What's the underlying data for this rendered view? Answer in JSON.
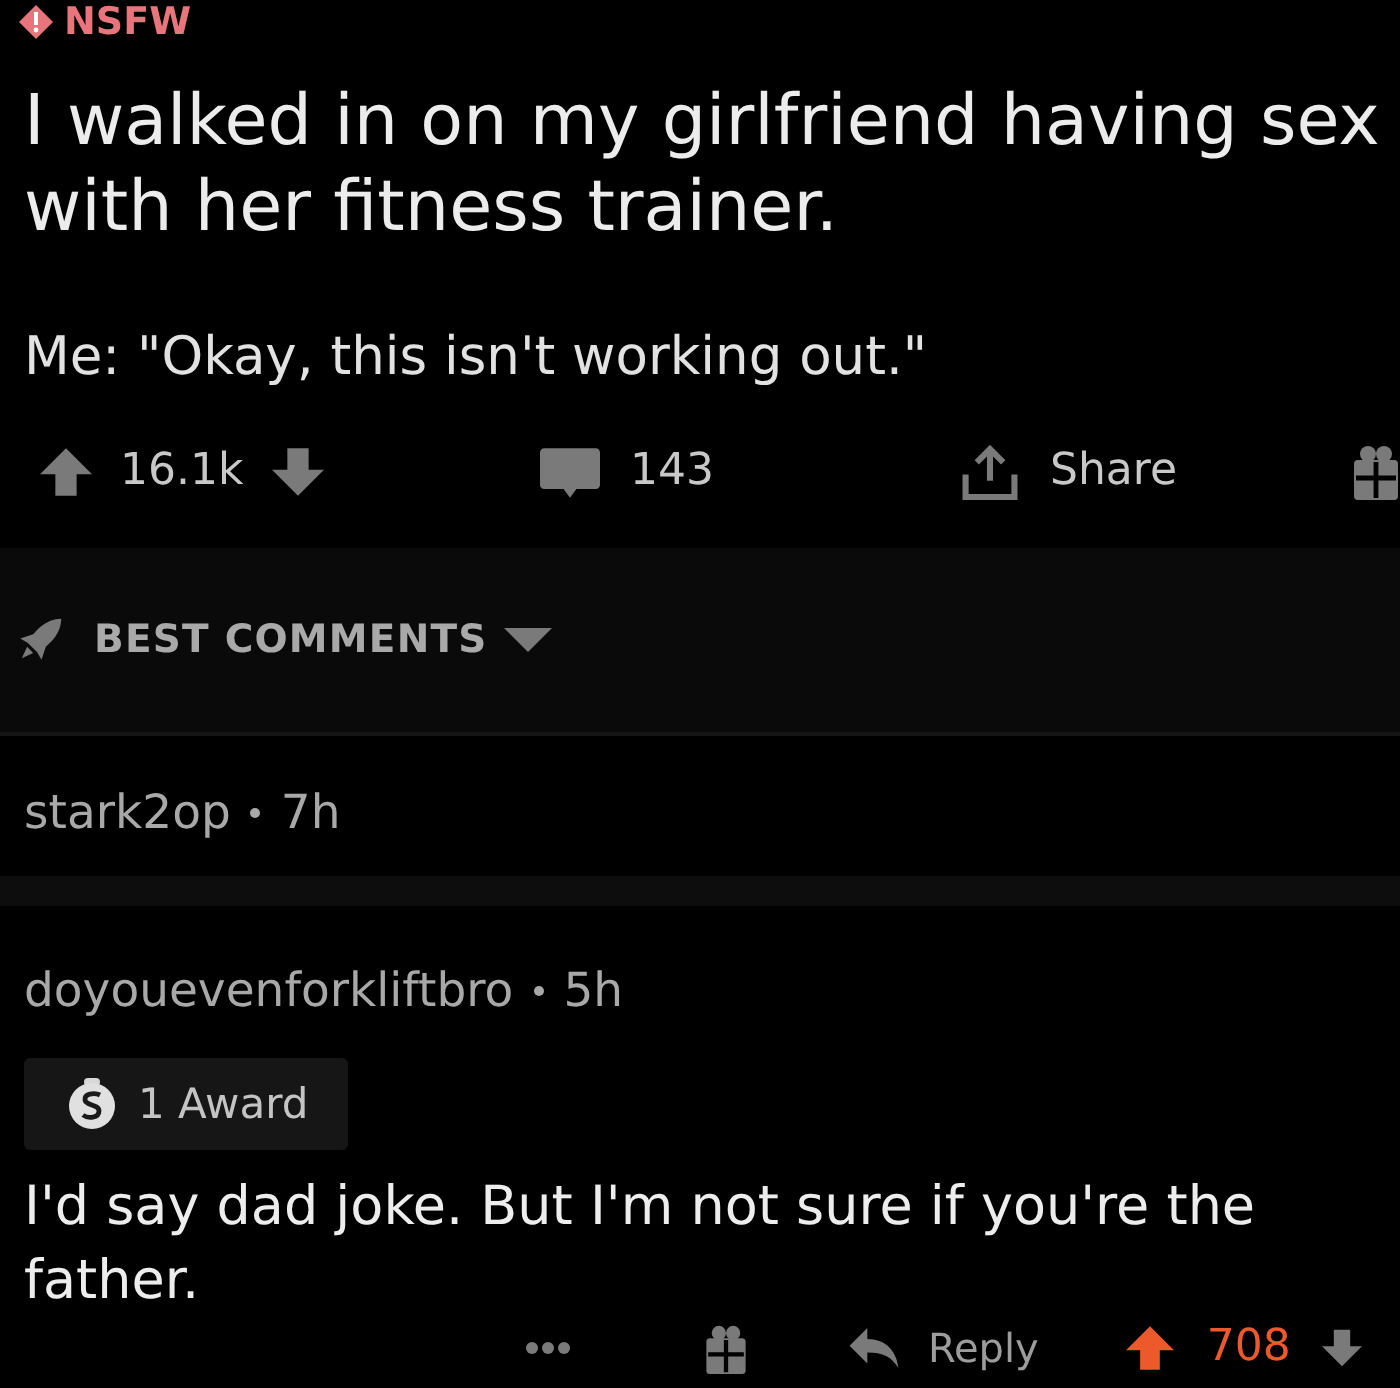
{
  "post": {
    "nsfw_label": "NSFW",
    "title": "I walked in on my girlfriend having sex with her fitness trainer.",
    "body": "Me: \"Okay, this isn't working out.\"",
    "upvoted": false,
    "score": "16.1k",
    "comment_count": "143",
    "share_label": "Share"
  },
  "sort": {
    "label": "BEST COMMENTS"
  },
  "comments": [
    {
      "author": "stark2op",
      "age": "7h"
    },
    {
      "author": "doyouevenforkliftbro",
      "age": "5h",
      "award": "1 Award",
      "text": "I'd say dad joke. But I'm not sure if you're the father.",
      "reply_label": "Reply",
      "upvoted": true,
      "score": "708"
    }
  ]
}
